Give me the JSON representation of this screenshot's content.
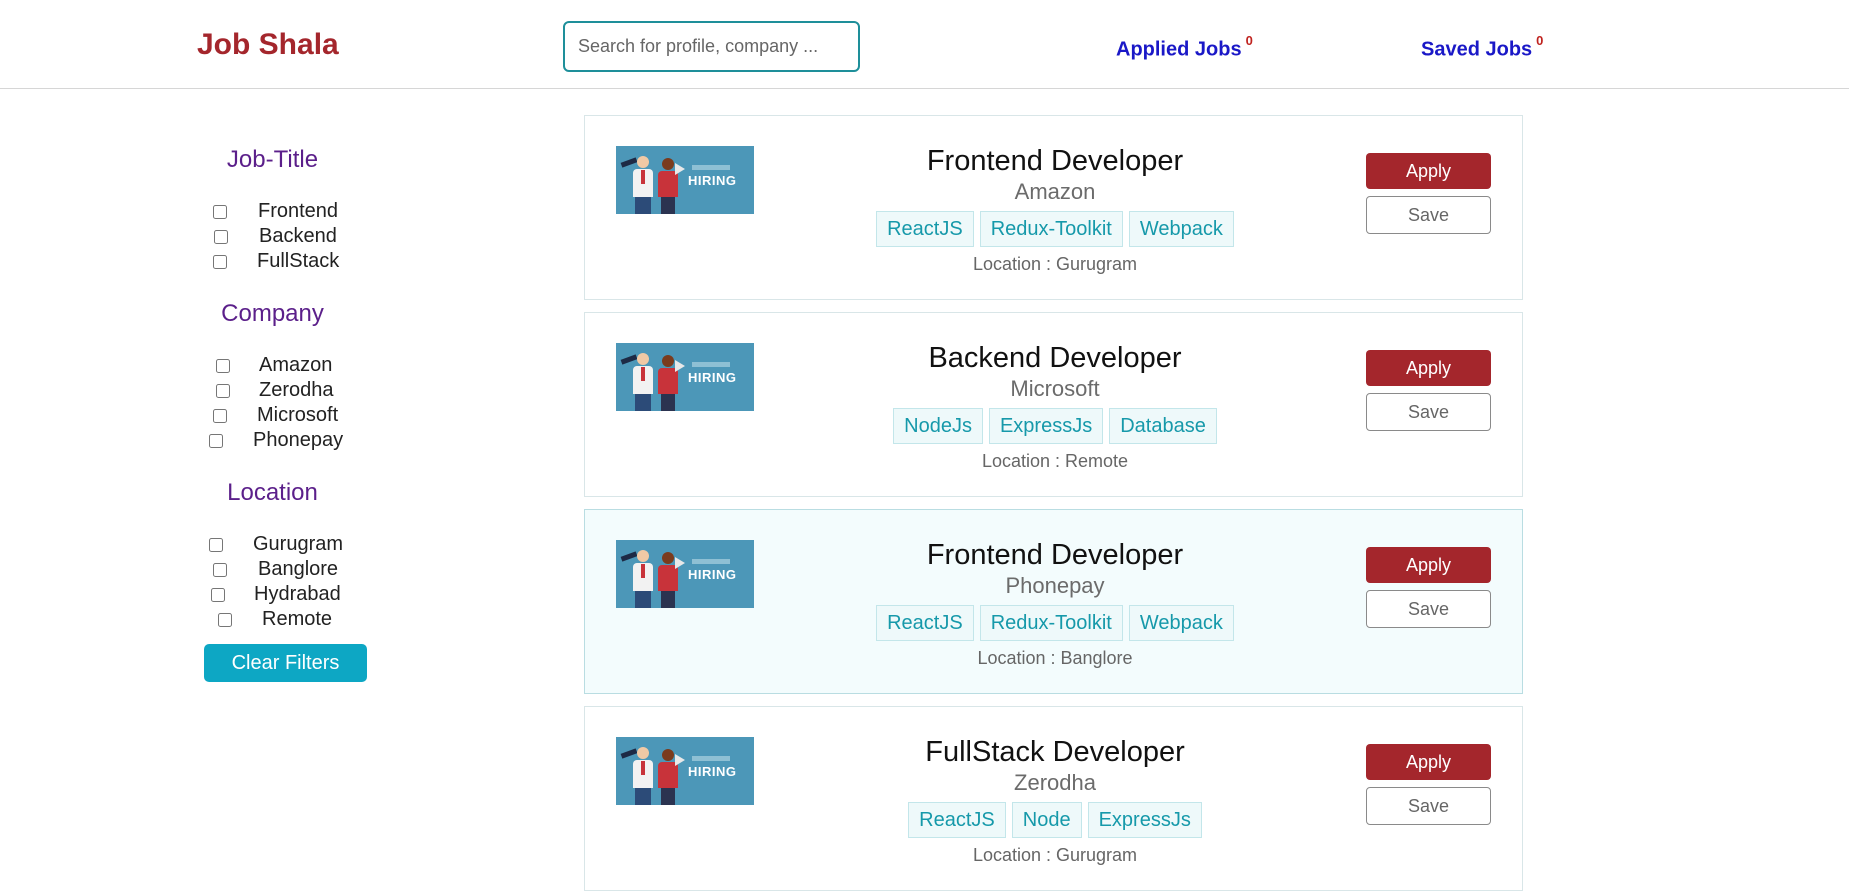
{
  "header": {
    "brand": "Job Shala",
    "search_placeholder": "Search for profile, company ...",
    "search_value": "",
    "applied_label": "Applied Jobs",
    "applied_count": "0",
    "saved_label": "Saved Jobs",
    "saved_count": "0"
  },
  "filters": {
    "job_title": {
      "heading": "Job-Title",
      "options": [
        "Frontend",
        "Backend",
        "FullStack"
      ]
    },
    "company": {
      "heading": "Company",
      "options": [
        "Amazon",
        "Zerodha",
        "Microsoft",
        "Phonepay"
      ]
    },
    "location": {
      "heading": "Location",
      "options": [
        "Gurugram",
        "Banglore",
        "Hydrabad",
        "Remote"
      ]
    },
    "clear_label": "Clear Filters"
  },
  "jobs": [
    {
      "title": "Frontend Developer",
      "company": "Amazon",
      "tags": [
        "ReactJS",
        "Redux-Toolkit",
        "Webpack"
      ],
      "location": "Location : Gurugram",
      "apply_label": "Apply",
      "save_label": "Save",
      "logo_text": "HIRING"
    },
    {
      "title": "Backend Developer",
      "company": "Microsoft",
      "tags": [
        "NodeJs",
        "ExpressJs",
        "Database"
      ],
      "location": "Location : Remote",
      "apply_label": "Apply",
      "save_label": "Save",
      "logo_text": "HIRING"
    },
    {
      "title": "Frontend Developer",
      "company": "Phonepay",
      "tags": [
        "ReactJS",
        "Redux-Toolkit",
        "Webpack"
      ],
      "location": "Location : Banglore",
      "apply_label": "Apply",
      "save_label": "Save",
      "logo_text": "HIRING"
    },
    {
      "title": "FullStack Developer",
      "company": "Zerodha",
      "tags": [
        "ReactJS",
        "Node",
        "ExpressJs"
      ],
      "location": "Location : Gurugram",
      "apply_label": "Apply",
      "save_label": "Save",
      "logo_text": "HIRING"
    }
  ],
  "colors": {
    "brand": "#a4262c",
    "nav_link": "#1a18c7",
    "filter_heading": "#5b1f8a",
    "clear_button": "#0da7c4",
    "tag_text": "#1699aa",
    "apply_button": "#a4262c",
    "search_border": "#1e8f9a"
  }
}
